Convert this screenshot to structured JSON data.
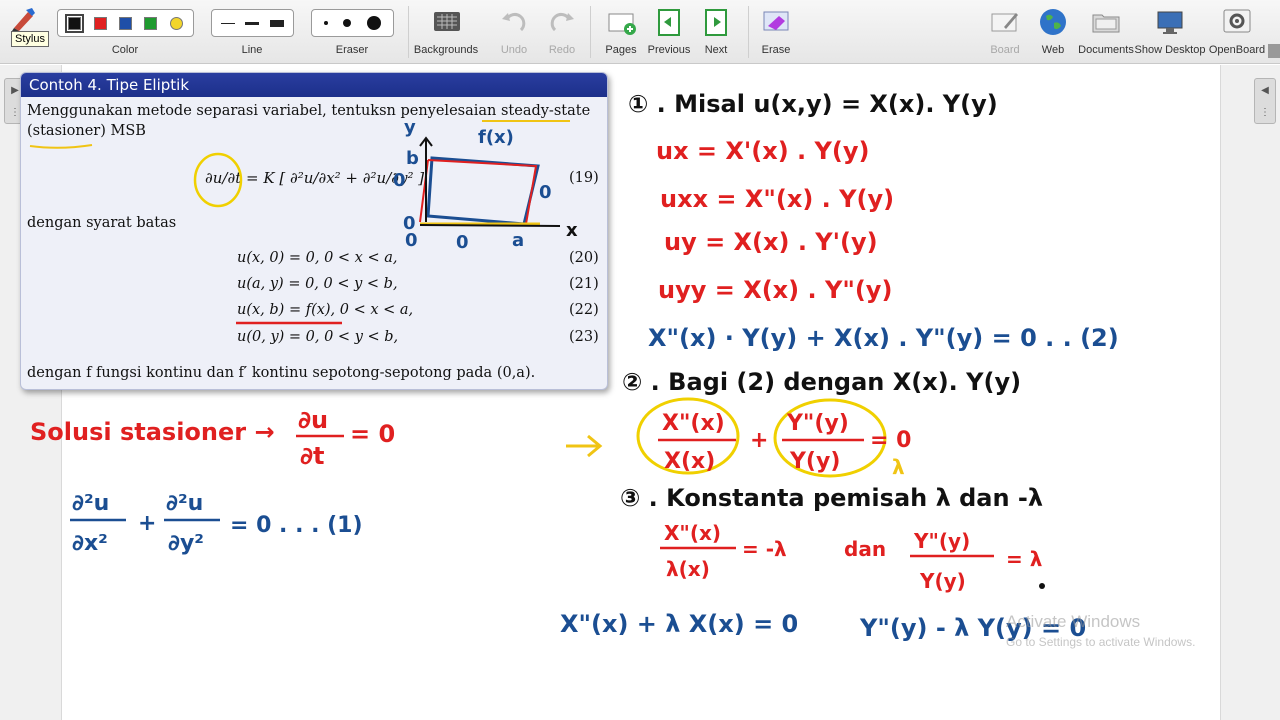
{
  "toolbar": {
    "stylus_label": "Stylus",
    "tooltip": "Stylus",
    "color_label": "Color",
    "line_label": "Line",
    "eraser_label": "Eraser",
    "backgrounds_label": "Backgrounds",
    "undo_label": "Undo",
    "redo_label": "Redo",
    "pages_label": "Pages",
    "previous_label": "Previous",
    "next_label": "Next",
    "erase_label": "Erase",
    "board_label": "Board",
    "web_label": "Web",
    "documents_label": "Documents",
    "show_desktop_label": "Show Desktop",
    "openboard_label": "OpenBoard",
    "colors": [
      "#111111",
      "#e02020",
      "#1f4fa8",
      "#1f9a2f",
      "#f2d52b"
    ]
  },
  "slide": {
    "title": "Contoh 4. Tipe Eliptik",
    "intro_line1": "Menggunakan metode separasi variabel, tentuksn penyelesaian steady-state",
    "intro_line2": "(stasioner) MSB",
    "main_eq": "∂u/∂t = K [ ∂²u/∂x² + ∂²u/∂y² ]",
    "main_eq_num": "(19)",
    "boundary_label": "dengan syarat batas",
    "conditions": [
      {
        "text": "u(x, 0) = 0, 0 < x < a,",
        "num": "(20)"
      },
      {
        "text": "u(a, y) = 0, 0 < y < b,",
        "num": "(21)"
      },
      {
        "text": "u(x, b) = f(x), 0 < x < a,",
        "num": "(22)"
      },
      {
        "text": "u(0, y) = 0, 0 < y < b,",
        "num": "(23)"
      }
    ],
    "footer": "dengan f fungsi kontinu dan f′ kontinu sepotong-sepotong pada (0,a)."
  },
  "watermark": {
    "line1": "Activate Windows",
    "line2": "Go to Settings to activate Windows."
  }
}
